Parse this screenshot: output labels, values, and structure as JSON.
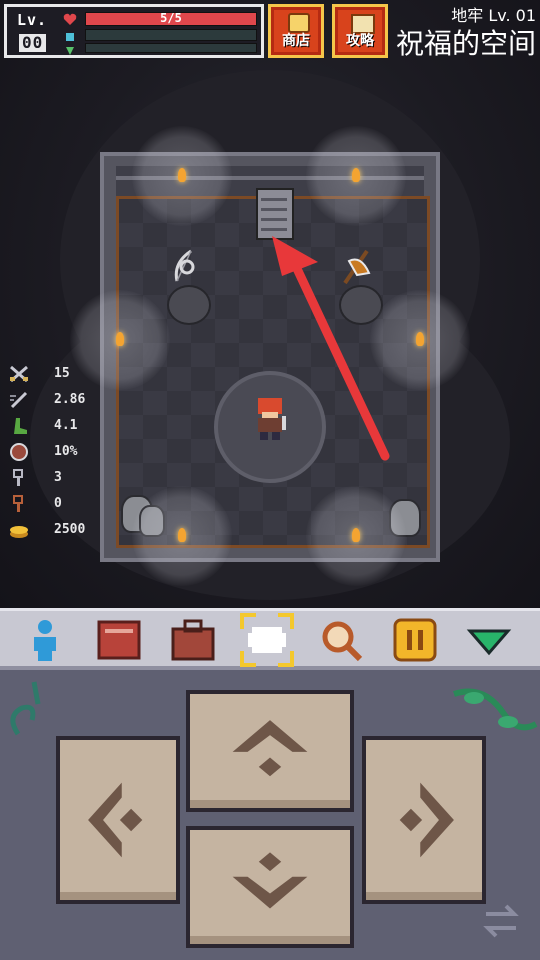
{
  "hud": {
    "level_label": "Lv.",
    "level_value": "00",
    "hp_text": "5/5",
    "hp_fraction": 1.0,
    "mp_fraction": 0.0,
    "xp_fraction": 0.0
  },
  "buttons": {
    "shop_label": "商店",
    "guide_label": "攻略"
  },
  "dungeon": {
    "level_text": "地牢 Lv. 01",
    "room_name": "祝福的空间"
  },
  "stats": [
    {
      "icon": "crossed-swords-icon",
      "value": "15"
    },
    {
      "icon": "sword-speed-icon",
      "value": "2.86"
    },
    {
      "icon": "boot-icon",
      "value": "4.1"
    },
    {
      "icon": "shield-icon",
      "value": "10%"
    },
    {
      "icon": "silver-key-icon",
      "value": "3"
    },
    {
      "icon": "bronze-key-icon",
      "value": "0"
    },
    {
      "icon": "gold-coin-icon",
      "value": "2500"
    }
  ],
  "toolbar": {
    "items": [
      "character-icon",
      "spellbook-icon",
      "backpack-icon",
      "map-icon",
      "magnifier-icon",
      "pause-icon",
      "collapse-icon"
    ],
    "selected": "map-icon"
  },
  "colors": {
    "hp": "#e0474c",
    "accent": "#f4c82d",
    "button_red": "#d8431c",
    "pad_button": "#c5b4a1"
  }
}
